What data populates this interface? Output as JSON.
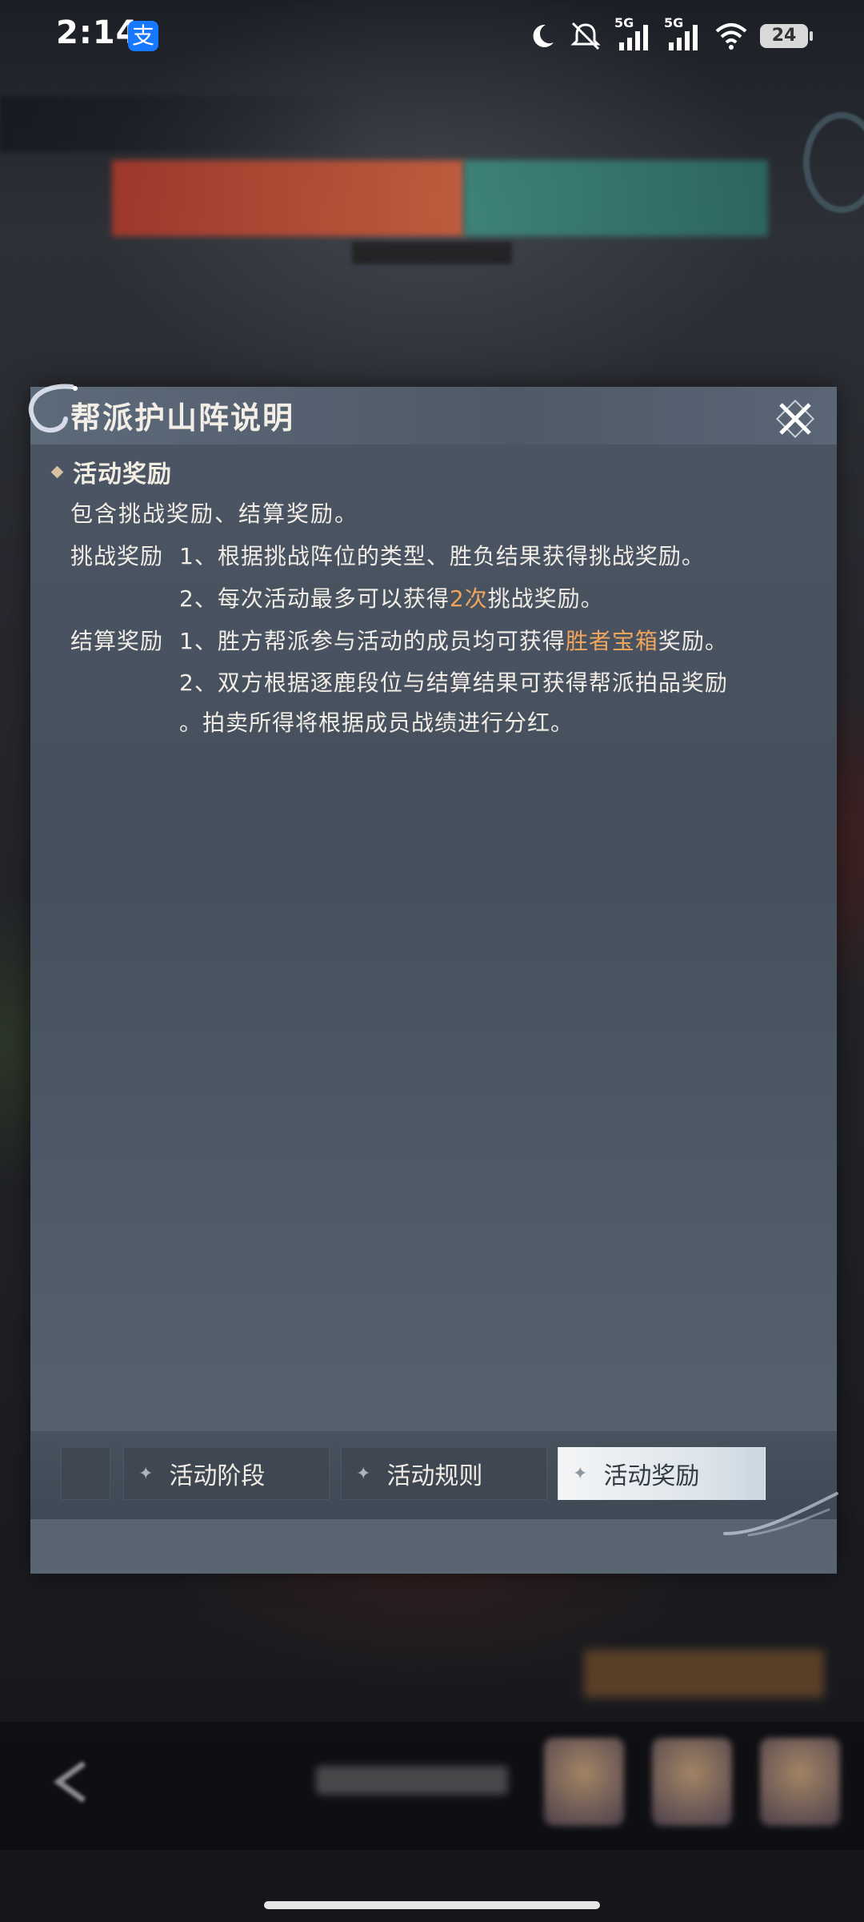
{
  "status_bar": {
    "time": "2:14",
    "app_icon_glyph": "支",
    "battery": "24",
    "network_1": "5G",
    "network_2": "5G"
  },
  "dialog": {
    "title": "帮派护山阵说明",
    "section": "活动奖励",
    "intro": "包含挑战奖励、结算奖励。",
    "challenge": {
      "label": "挑战奖励",
      "line1": "1、根据挑战阵位的类型、胜负结果获得挑战奖励。",
      "line2_pre": "2、每次活动最多可以获得",
      "line2_hl": "2次",
      "line2_post": "挑战奖励。"
    },
    "settlement": {
      "label": "结算奖励",
      "line1_pre": "1、胜方帮派参与活动的成员均可获得",
      "line1_hl": "胜者宝箱",
      "line1_post": "奖励。",
      "line2": "2、双方根据逐鹿段位与结算结果可获得帮派拍品奖励",
      "line3": "。拍卖所得将根据成员战绩进行分红。"
    },
    "tabs": [
      {
        "label": "活动阶段",
        "active": false
      },
      {
        "label": "活动规则",
        "active": false
      },
      {
        "label": "活动奖励",
        "active": true
      }
    ]
  },
  "colors": {
    "highlight": "#f0a55b",
    "dialog_bg": "#4b5563",
    "active_tab": "#f4f5f6"
  }
}
